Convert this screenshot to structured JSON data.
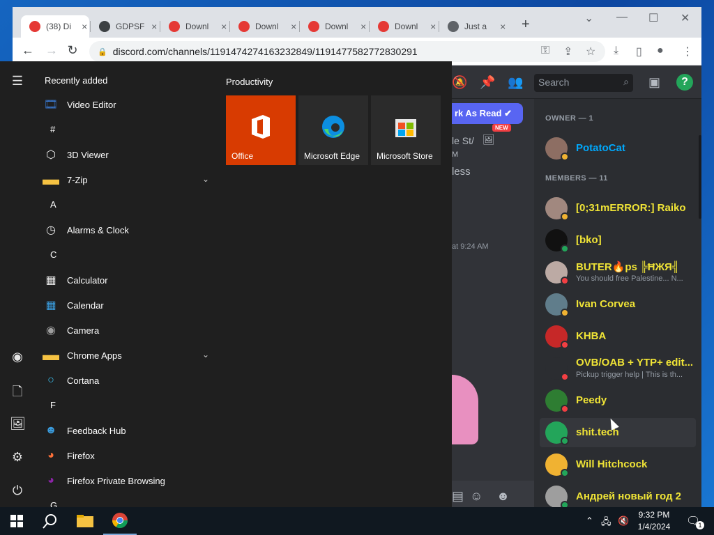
{
  "browser": {
    "tabs": [
      {
        "title": "(38) Di",
        "icon": "discord-icon",
        "favcolor": "#e53935",
        "active": true
      },
      {
        "title": "GDPSF",
        "icon": "shield-icon",
        "favcolor": "#3c4043"
      },
      {
        "title": "Downl",
        "icon": "download-icon",
        "favcolor": "#e53935"
      },
      {
        "title": "Downl",
        "icon": "download-icon",
        "favcolor": "#e53935"
      },
      {
        "title": "Downl",
        "icon": "download-icon",
        "favcolor": "#e53935"
      },
      {
        "title": "Downl",
        "icon": "download-icon",
        "favcolor": "#e53935"
      },
      {
        "title": "Just a",
        "icon": "globe-icon",
        "favcolor": "#5f6368"
      }
    ],
    "close_glyph": "×",
    "url": "discord.com/channels/1191474274163232849/1191477582772830291"
  },
  "discord": {
    "search_placeholder": "Search",
    "mark_as_read": "rk As Read",
    "new_badge": "NEW",
    "chat_snippets": [
      "le St/",
      "M",
      "less"
    ],
    "chat_time": "at 9:24 AM",
    "owner_header": "OWNER — 1",
    "members_header": "MEMBERS — 11",
    "owner": {
      "name": "PotatoCat",
      "color": "#00a8fc",
      "avatar": "#8d6e63",
      "status": "#f0b232"
    },
    "members": [
      {
        "name": "[0;31mERROR:] Raiko",
        "sub": "",
        "avatar": "#a1887f",
        "status": "#f0b232"
      },
      {
        "name": "[bko]",
        "sub": "",
        "avatar": "#111111",
        "status": "#23a55a"
      },
      {
        "name": "BUTER🔥ps ╠ĦЖЯ╣",
        "sub": "You should free Palestine... N...",
        "avatar": "#bcaaa4",
        "status": "#f23f43"
      },
      {
        "name": "Ivan Corvea",
        "sub": "",
        "avatar": "#607d8b",
        "status": "#f0b232"
      },
      {
        "name": "KHBA",
        "sub": "",
        "avatar": "#c62828",
        "status": "#f23f43"
      },
      {
        "name": "OVB/OAB + YTP+ edit...",
        "sub": "Pickup trigger help | This is th...",
        "avatar": "#2b2d31",
        "status": "#f23f43"
      },
      {
        "name": "Peedy",
        "sub": "",
        "avatar": "#2e7d32",
        "status": "#f23f43"
      },
      {
        "name": "shit.tech",
        "sub": "",
        "avatar": "#23a55a",
        "status": "#23a55a"
      },
      {
        "name": "Will Hitchcock",
        "sub": "",
        "avatar": "#f0b232",
        "status": "#23a55a"
      },
      {
        "name": "Андрей новый год 2",
        "sub": "",
        "avatar": "#9e9e9e",
        "status": "#23a55a"
      }
    ]
  },
  "startmenu": {
    "recently_added": "Recently added",
    "productivity": "Productivity",
    "apps": [
      {
        "label": "Video Editor",
        "kind": "app",
        "icon": "video-editor-icon"
      },
      {
        "label": "#",
        "kind": "letter"
      },
      {
        "label": "3D Viewer",
        "kind": "app",
        "icon": "cube-icon"
      },
      {
        "label": "7-Zip",
        "kind": "folder",
        "icon": "folder-icon"
      },
      {
        "label": "A",
        "kind": "letter"
      },
      {
        "label": "Alarms & Clock",
        "kind": "app",
        "icon": "clock-icon"
      },
      {
        "label": "C",
        "kind": "letter"
      },
      {
        "label": "Calculator",
        "kind": "app",
        "icon": "calculator-icon"
      },
      {
        "label": "Calendar",
        "kind": "app",
        "icon": "calendar-icon"
      },
      {
        "label": "Camera",
        "kind": "app",
        "icon": "camera-icon"
      },
      {
        "label": "Chrome Apps",
        "kind": "folder",
        "icon": "folder-icon"
      },
      {
        "label": "Cortana",
        "kind": "app",
        "icon": "cortana-icon"
      },
      {
        "label": "F",
        "kind": "letter"
      },
      {
        "label": "Feedback Hub",
        "kind": "app",
        "icon": "feedback-icon"
      },
      {
        "label": "Firefox",
        "kind": "app",
        "icon": "firefox-icon"
      },
      {
        "label": "Firefox Private Browsing",
        "kind": "app",
        "icon": "firefox-private-icon"
      },
      {
        "label": "G",
        "kind": "letter"
      }
    ],
    "tiles": [
      {
        "label": "Office",
        "color": "#d83b01",
        "icon": "office-icon"
      },
      {
        "label": "Microsoft Edge",
        "color": "#2b2b2b",
        "icon": "edge-icon"
      },
      {
        "label": "Microsoft Store",
        "color": "#2b2b2b",
        "icon": "store-icon"
      }
    ]
  },
  "taskbar": {
    "time": "9:32 PM",
    "date": "1/4/2024",
    "notification_count": "1"
  }
}
